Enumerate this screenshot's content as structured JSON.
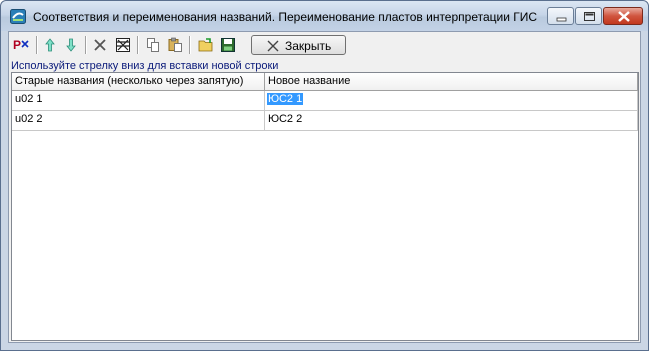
{
  "window": {
    "title": "Соответствия и переименования названий. Переименование пластов интерпретации ГИС"
  },
  "toolbar": {
    "close_label": "Закрыть",
    "icons": [
      "p-mark-icon",
      "arrow-up-icon",
      "arrow-down-icon",
      "delete-icon",
      "delete-all-icon",
      "copy-icon",
      "paste-icon",
      "open-folder-icon",
      "save-icon",
      "close-icon"
    ]
  },
  "hint": "Используйте стрелку вниз для вставки новой строки",
  "table": {
    "columns": [
      "Старые названия (несколько через запятую)",
      "Новое название"
    ],
    "rows": [
      [
        "u02 1",
        "ЮС2 1"
      ],
      [
        "u02 2",
        "ЮС2 2"
      ]
    ],
    "selected": {
      "row": 0,
      "col": 1
    }
  },
  "colors": {
    "selection": "#3399ff",
    "hint_text": "#0a1a7a",
    "close_button": "#c2381e"
  }
}
